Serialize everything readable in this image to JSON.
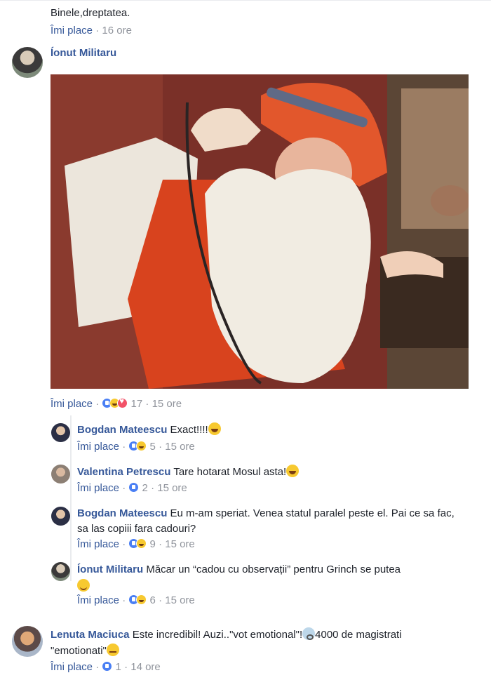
{
  "top_comment": {
    "text": "Binele,dreptatea.",
    "like_label": "Îmi place",
    "time": "16 ore"
  },
  "main_comment": {
    "author": "Íonut Militaru",
    "like_label": "Îmi place",
    "reaction_count": "17",
    "time": "15 ore",
    "reactions": [
      "like-icon",
      "haha-icon",
      "love-icon"
    ]
  },
  "replies": [
    {
      "author": "Bogdan Mateescu",
      "text": "Exact!!!!",
      "emoji": "laugh-emoji",
      "like_label": "Îmi place",
      "count": "5",
      "time": "15 ore",
      "reactions": [
        "like-icon",
        "haha-icon"
      ]
    },
    {
      "author": "Valentina Petrescu",
      "text": "Tare hotarat Mosul asta!",
      "emoji": "laugh-emoji",
      "like_label": "Îmi place",
      "count": "2",
      "time": "15 ore",
      "reactions": [
        "like-icon"
      ]
    },
    {
      "author": "Bogdan Mateescu",
      "text": "Eu m-am speriat. Venea statul paralel peste el. Pai ce sa fac, sa las copiii fara cadouri?",
      "like_label": "Îmi place",
      "count": "9",
      "time": "15 ore",
      "reactions": [
        "like-icon",
        "haha-icon"
      ]
    },
    {
      "author": "Íonut Militaru",
      "text": "Măcar un “cadou cu observații” pentru Grinch se putea",
      "emoji": "smile-emoji",
      "like_label": "Îmi place",
      "count": "6",
      "time": "15 ore",
      "reactions": [
        "like-icon",
        "haha-icon"
      ]
    }
  ],
  "last_comment": {
    "author": "Lenuta Maciuca",
    "text_a": "Este incredibil! Auzi..\"vot emotional\"!",
    "text_b": "4000 de magistrati",
    "text_c": "\"emotionati\"",
    "like_label": "Îmi place",
    "count": "1",
    "time": "14 ore"
  },
  "separator": "·"
}
